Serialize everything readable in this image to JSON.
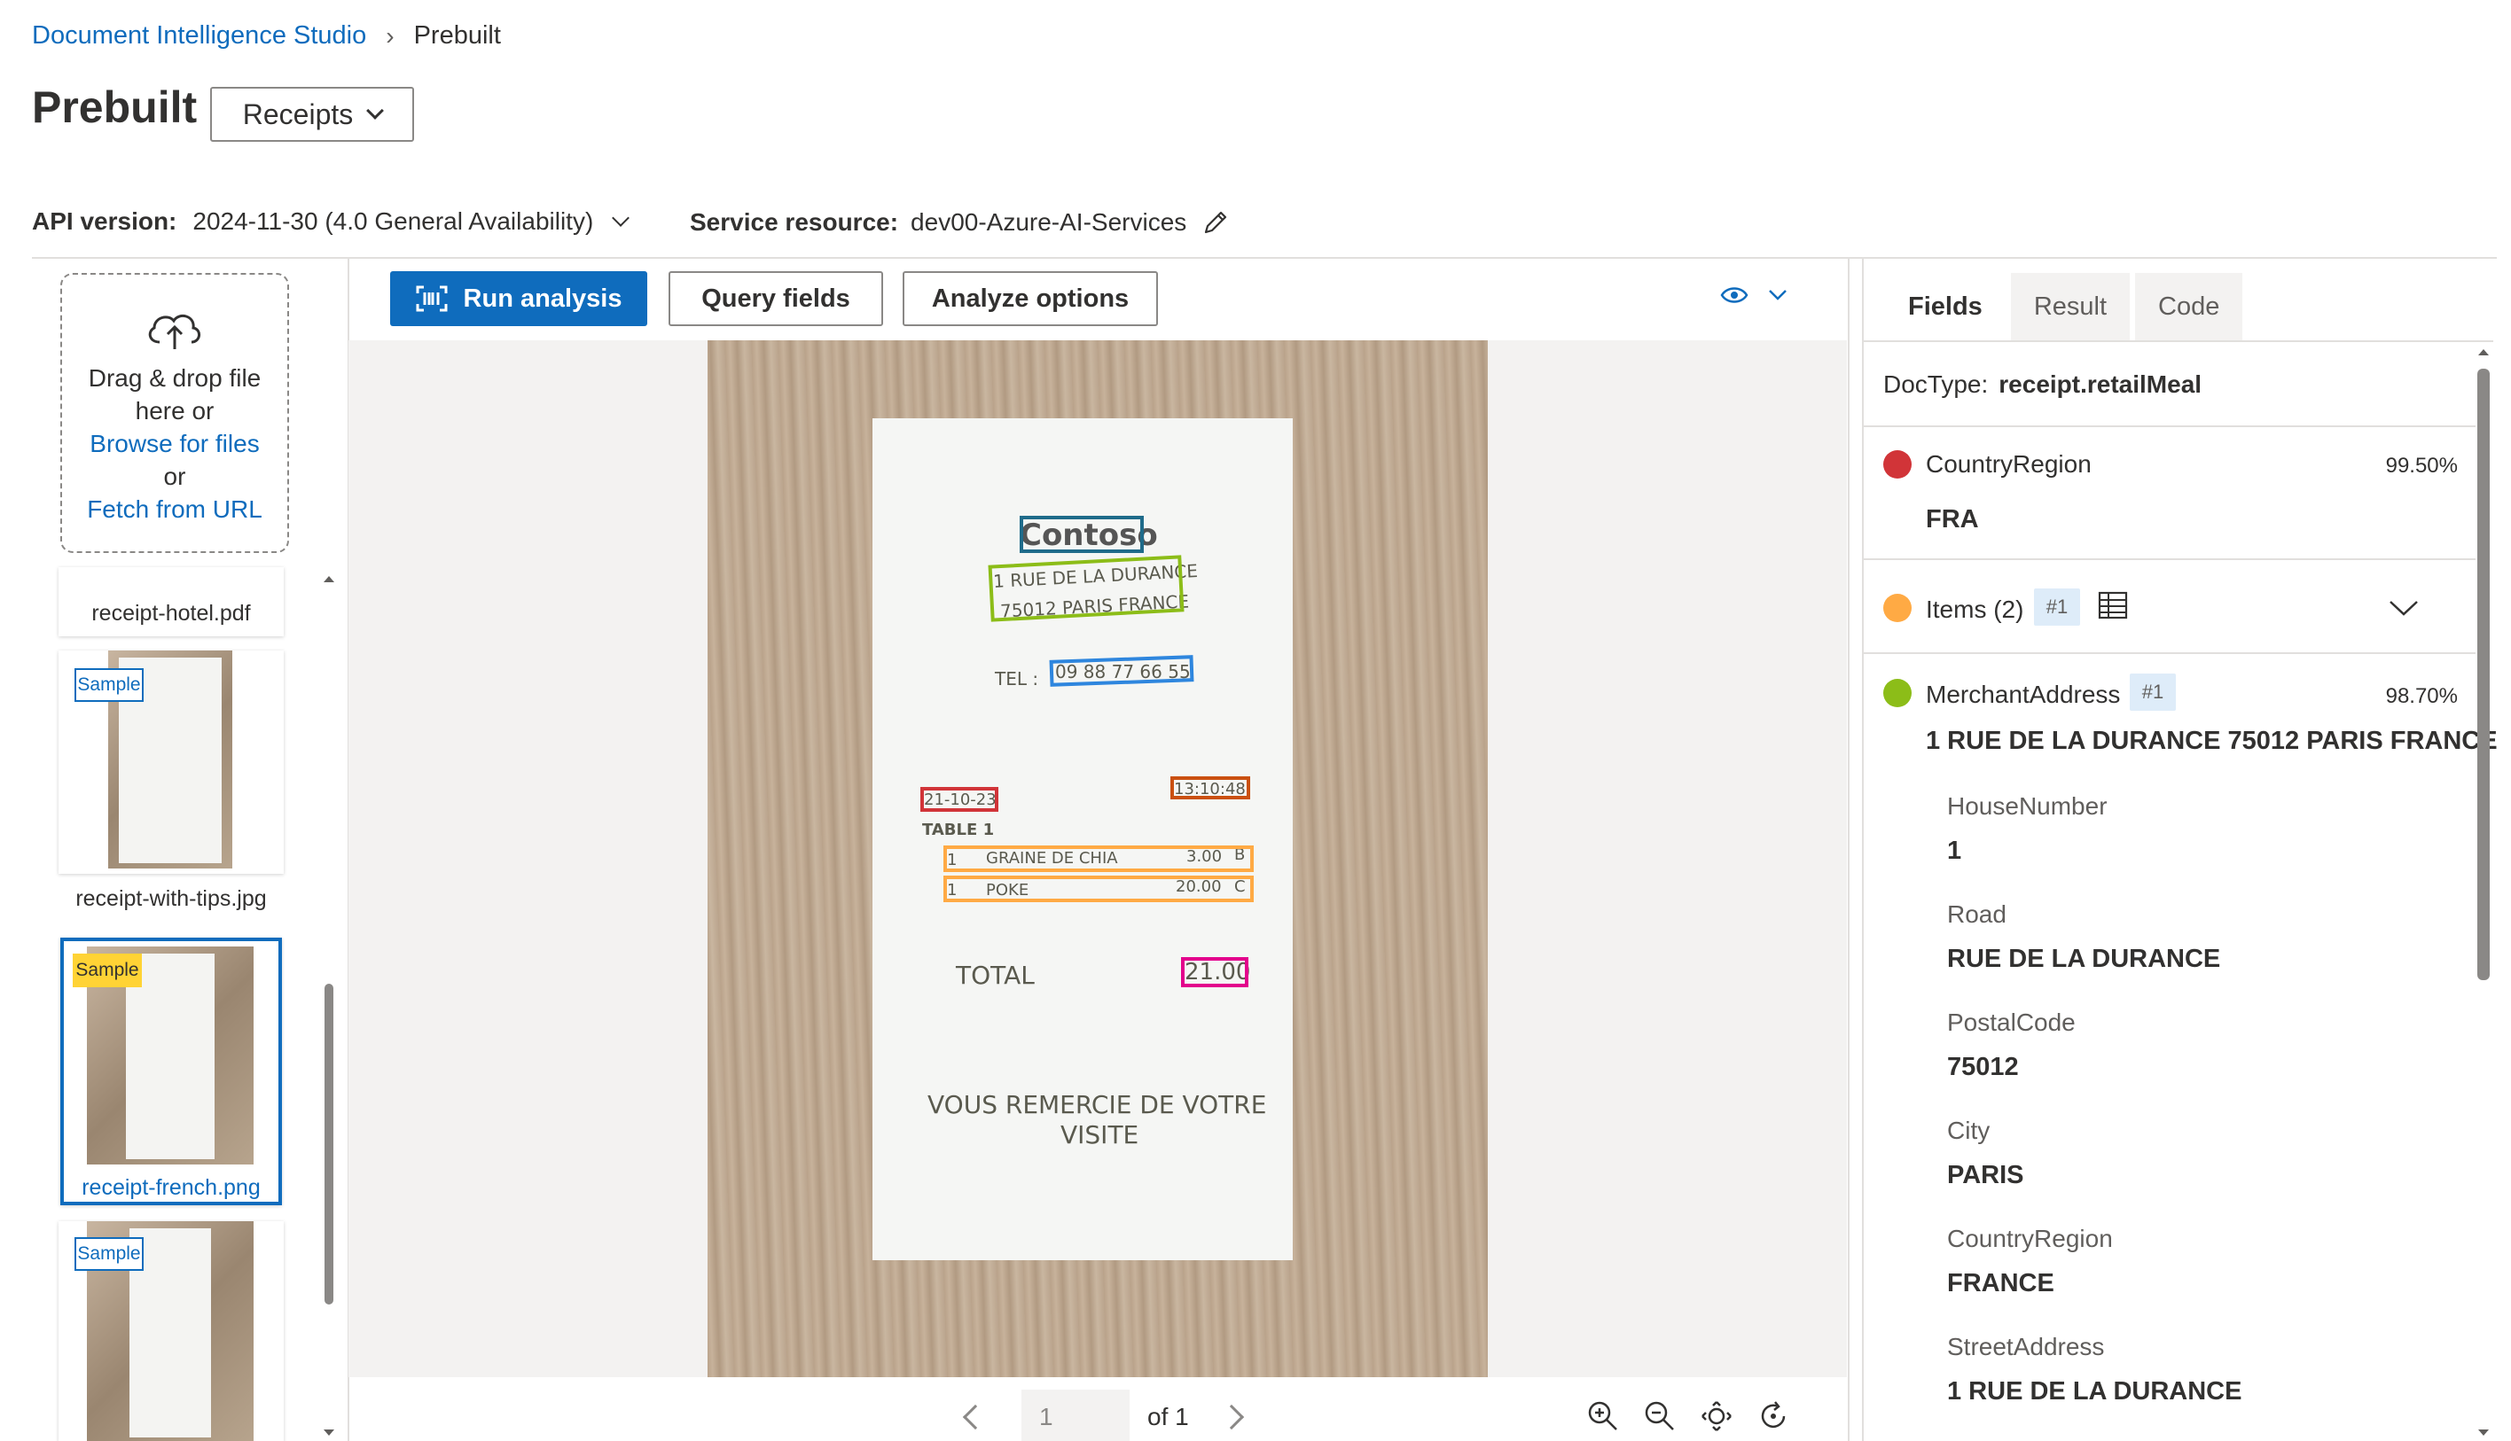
{
  "breadcrumb": {
    "root": "Document Intelligence Studio",
    "current": "Prebuilt"
  },
  "page_title": "Prebuilt",
  "model_select": {
    "value": "Receipts"
  },
  "api": {
    "label": "API version:",
    "value": "2024-11-30 (4.0 General Availability)"
  },
  "service": {
    "label": "Service resource:",
    "value": "dev00-Azure-AI-Services"
  },
  "dropzone": {
    "line1": "Drag & drop file",
    "line2": "here or",
    "browse": "Browse for files",
    "or": "or",
    "fetch": "Fetch from URL"
  },
  "files": [
    {
      "name": "receipt-hotel.pdf",
      "sample": ""
    },
    {
      "name": "receipt-with-tips.jpg",
      "sample": "Sample"
    },
    {
      "name": "receipt-french.png",
      "sample": "Sample",
      "selected": true
    },
    {
      "name": "",
      "sample": "Sample"
    }
  ],
  "toolbar": {
    "run": "Run analysis",
    "query": "Query fields",
    "options": "Analyze options"
  },
  "receipt": {
    "merchant": "Contoso",
    "address1": "1 RUE DE LA DURANCE",
    "address2": "75012 PARIS FRANCE",
    "tel_label": "TEL :",
    "tel": "09 88 77 66 55",
    "date": "21-10-23",
    "time": "13:10:48",
    "table": "TABLE 1",
    "items": [
      {
        "qty": "1",
        "desc": "GRAINE DE CHIA",
        "price": "3.00",
        "code": "B"
      },
      {
        "qty": "1",
        "desc": "POKE",
        "price": "20.00",
        "code": "C"
      }
    ],
    "total_label": "TOTAL",
    "total": "21.00",
    "footer1": "VOUS REMERCIE DE VOTRE",
    "footer2": "VISITE"
  },
  "pager": {
    "page": "1",
    "of": "of 1"
  },
  "tabs": [
    "Fields",
    "Result",
    "Code"
  ],
  "doctype": {
    "label": "DocType:",
    "value": "receipt.retailMeal"
  },
  "fields": {
    "country": {
      "name": "CountryRegion",
      "confidence": "99.50%",
      "value": "FRA",
      "color": "#d13438"
    },
    "items": {
      "name": "Items (2)",
      "badge": "#1",
      "color": "#ffaa44"
    },
    "merchant_address": {
      "name": "MerchantAddress",
      "badge": "#1",
      "confidence": "98.70%",
      "value": "1 RUE DE LA DURANCE 75012 PARIS FRANCE",
      "color": "#8cbd18"
    }
  },
  "address_parts": [
    {
      "name": "HouseNumber",
      "value": "1"
    },
    {
      "name": "Road",
      "value": "RUE DE LA DURANCE"
    },
    {
      "name": "PostalCode",
      "value": "75012"
    },
    {
      "name": "City",
      "value": "PARIS"
    },
    {
      "name": "CountryRegion",
      "value": "FRANCE"
    },
    {
      "name": "StreetAddress",
      "value": "1 RUE DE LA DURANCE"
    }
  ],
  "colors": {
    "accent": "#0f6cbd",
    "merchant_box": "#1f6b8a",
    "address_box": "#8cbd18",
    "phone_box": "#2e86de",
    "date_box": "#d13438",
    "time_box": "#ca5010",
    "items_box": "#ffaa44",
    "total_box": "#e3008c"
  }
}
